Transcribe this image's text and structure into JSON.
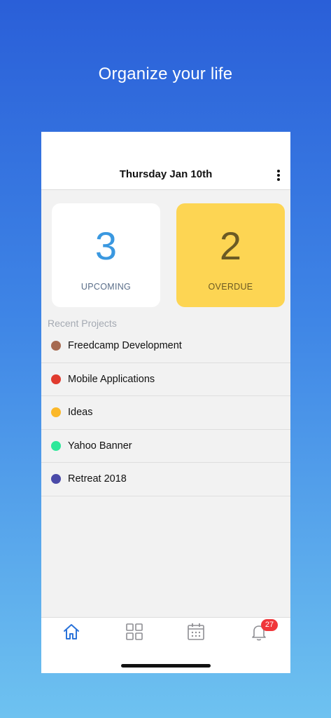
{
  "headline": "Organize your life",
  "header": {
    "date": "Thursday Jan 10th",
    "menu_icon": "kebab-menu-icon"
  },
  "summary": {
    "upcoming": {
      "count": "3",
      "label": "UPCOMING"
    },
    "overdue": {
      "count": "2",
      "label": "OVERDUE"
    }
  },
  "recent_projects": {
    "title": "Recent Projects",
    "items": [
      {
        "name": "Freedcamp Development",
        "color": "#a66a50"
      },
      {
        "name": "Mobile Applications",
        "color": "#e03b2f"
      },
      {
        "name": "Ideas",
        "color": "#fbb829"
      },
      {
        "name": "Yahoo Banner",
        "color": "#2ee89a"
      },
      {
        "name": "Retreat 2018",
        "color": "#4a4aa8"
      }
    ]
  },
  "tabbar": {
    "tabs": [
      {
        "icon": "home-icon",
        "active": true
      },
      {
        "icon": "grid-icon",
        "active": false
      },
      {
        "icon": "calendar-icon",
        "active": false
      },
      {
        "icon": "bell-icon",
        "active": false
      }
    ],
    "notifications_badge": "27"
  },
  "colors": {
    "accent": "#2b73d9",
    "overdue_card": "#fdd553",
    "badge": "#f0363a"
  }
}
